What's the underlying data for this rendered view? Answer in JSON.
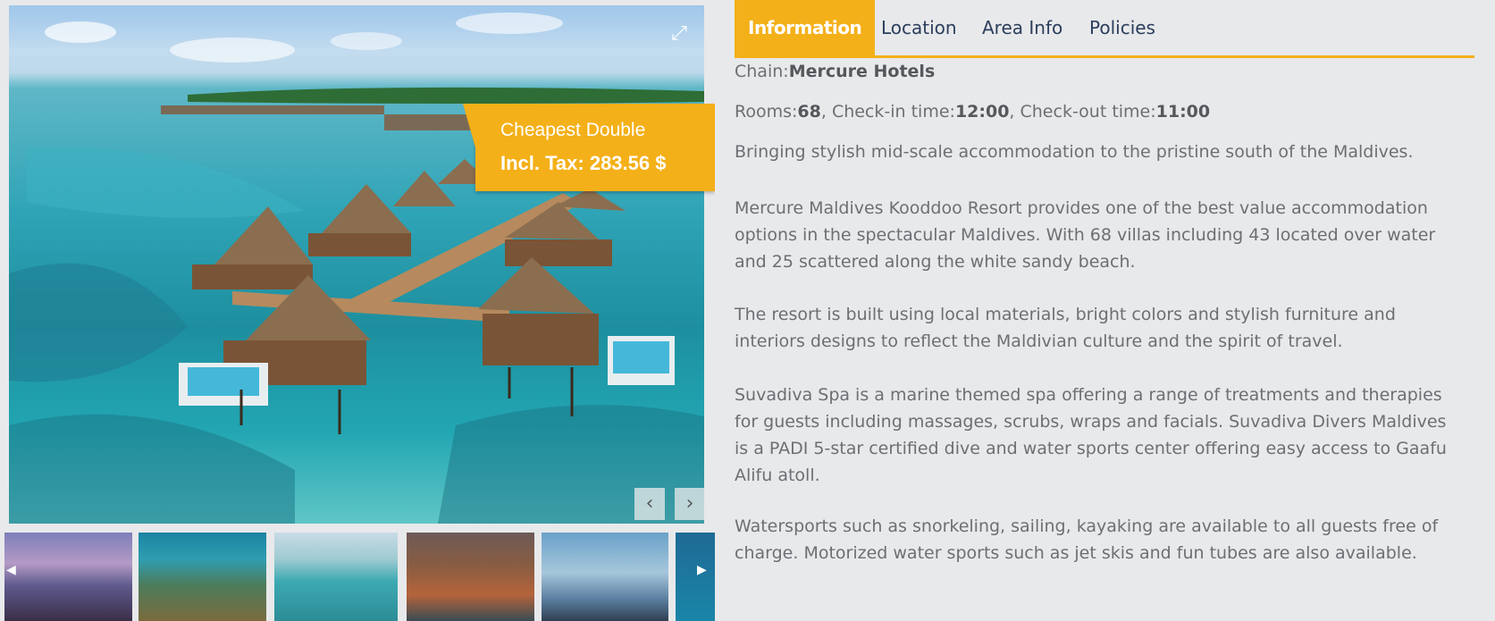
{
  "gallery": {
    "expand_icon": "expand-icon",
    "prev_label": "‹",
    "next_label": "›",
    "price_ribbon": {
      "title": "Cheapest Double",
      "price": "Incl. Tax: 283.56 $"
    },
    "thumb_prev": "◀",
    "thumb_next": "▶",
    "colors": {
      "accent": "#f4b018",
      "water": "#2fa4b6"
    }
  },
  "tabs": [
    {
      "label": "Information",
      "active": true
    },
    {
      "label": "Location"
    },
    {
      "label": "Area Info"
    },
    {
      "label": "Policies"
    }
  ],
  "info": {
    "chain_label": "Chain:",
    "chain_value": "Mercure Hotels",
    "rooms_label": "Rooms:",
    "rooms_value": "68",
    "checkin_label": ", Check-in time:",
    "checkin_value": "12:00",
    "checkout_label": ", Check-out time:",
    "checkout_value": "11:00",
    "paragraphs": [
      "Bringing stylish mid-scale accommodation to the pristine south of the Maldives.",
      "Mercure Maldives Kooddoo Resort provides one of the best value accommodation options in the spectacular Maldives. With 68 villas including 43 located over water and 25 scattered along the white sandy beach.",
      "The resort is built using local materials, bright colors and stylish furniture and interiors designs to reflect the Maldivian culture and the spirit of travel.",
      "Suvadiva Spa is a marine themed spa offering a range of treatments and therapies for guests including massages, scrubs, wraps and facials. Suvadiva Divers Maldives is a PADI 5-star certified dive and water sports center offering easy access to Gaafu Alifu atoll.",
      "Watersports such as snorkeling, sailing, kayaking are available to all guests free of charge. Motorized water sports such as jet skis and fun tubes are also available."
    ]
  }
}
